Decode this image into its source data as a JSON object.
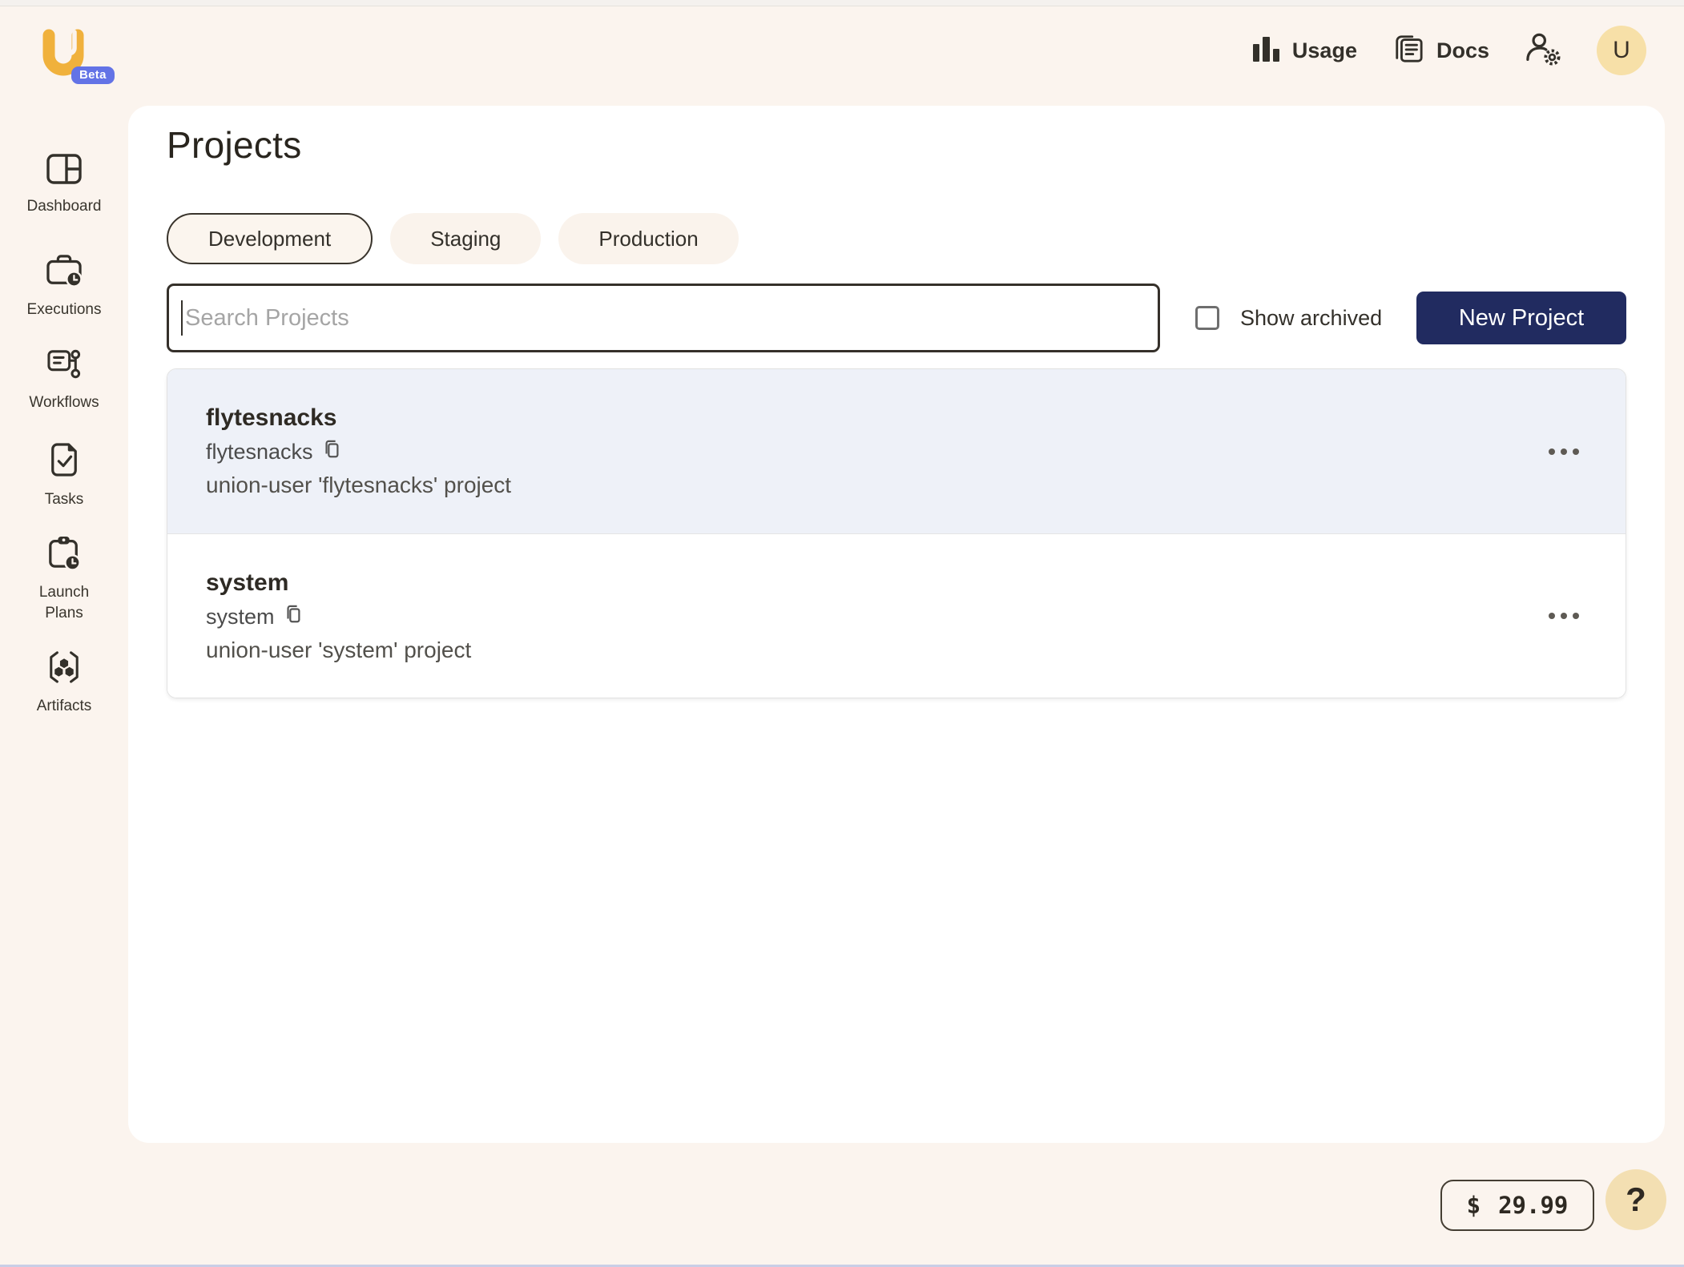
{
  "branding": {
    "beta_label": "Beta"
  },
  "header": {
    "usage_label": "Usage",
    "docs_label": "Docs",
    "avatar_initial": "U"
  },
  "sidebar": {
    "items": [
      {
        "label": "Dashboard",
        "icon": "dashboard-icon"
      },
      {
        "label": "Executions",
        "icon": "executions-icon"
      },
      {
        "label": "Workflows",
        "icon": "workflows-icon"
      },
      {
        "label": "Tasks",
        "icon": "tasks-icon"
      },
      {
        "label": "Launch Plans",
        "icon": "launch-plans-icon"
      },
      {
        "label": "Artifacts",
        "icon": "artifacts-icon"
      }
    ]
  },
  "main": {
    "title": "Projects",
    "domain_tabs": [
      {
        "label": "Development",
        "selected": true
      },
      {
        "label": "Staging",
        "selected": false
      },
      {
        "label": "Production",
        "selected": false
      }
    ],
    "search": {
      "placeholder": "Search Projects",
      "value": ""
    },
    "show_archived": {
      "label": "Show archived",
      "checked": false
    },
    "new_project_label": "New Project",
    "projects": [
      {
        "name": "flytesnacks",
        "id": "flytesnacks",
        "description": "union-user 'flytesnacks' project",
        "highlighted": true
      },
      {
        "name": "system",
        "id": "system",
        "description": "union-user 'system' project",
        "highlighted": false
      }
    ]
  },
  "footer": {
    "currency_symbol": "$",
    "credit_amount": "29.99",
    "help_label": "?"
  },
  "colors": {
    "background": "#FBF4EE",
    "panel": "#FFFFFF",
    "accent_navy": "#212B60",
    "logo_gold": "#F0B13C",
    "beta_badge_blue": "#6373E6",
    "avatar_yellow": "#F7E0A8",
    "help_yellow": "#F3DFB2",
    "row_highlight": "#EEF1F8",
    "text_primary": "#33302A",
    "text_secondary": "#52504B",
    "placeholder_gray": "#A5A5A5"
  }
}
